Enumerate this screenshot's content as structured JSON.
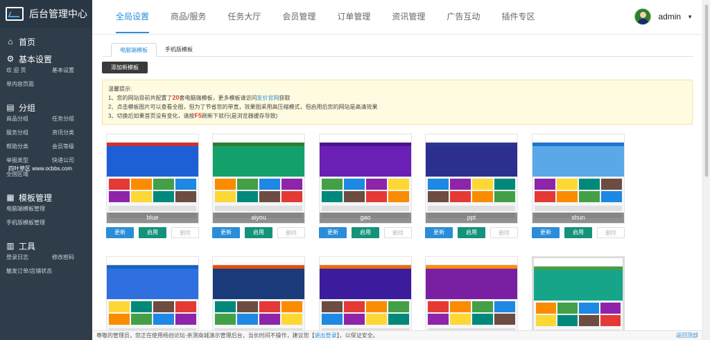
{
  "app": {
    "title": "后台管理中心"
  },
  "sidebar": {
    "groups": [
      {
        "icon": "home-icon",
        "glyph": "⌂",
        "label": "首页",
        "items": []
      },
      {
        "icon": "gear-icon",
        "glyph": "⚙",
        "label": "基本设置",
        "items": [
          "欢 迎 页",
          "基本设置",
          "单内容页面"
        ]
      },
      {
        "icon": "file-icon",
        "glyph": "▤",
        "label": "分组",
        "items": [
          "商品分组",
          "任务分组",
          "服务分组",
          "资讯分类",
          "帮助分类",
          "会员等级",
          "举报类型",
          "快递公司",
          "全国区域"
        ]
      },
      {
        "icon": "template-icon",
        "glyph": "▦",
        "label": "模板管理",
        "items": [
          "电脑端模板管理",
          "手机版模板管理"
        ]
      },
      {
        "icon": "chart-icon",
        "glyph": "▥",
        "label": "工具",
        "items": [
          "登录日志",
          "修改密码",
          "触发订单/店铺状态"
        ]
      }
    ],
    "watermark": "四叶草区  www.ocbbs.com"
  },
  "topnav": {
    "tabs": [
      "全局设置",
      "商品/服务",
      "任务大厅",
      "会员管理",
      "订单管理",
      "资讯管理",
      "广告互动",
      "插件专区"
    ],
    "active": 0
  },
  "user": {
    "name": "admin"
  },
  "subtabs": {
    "tabs": [
      "电脑端模板",
      "手机版模板"
    ],
    "active": 0
  },
  "toolbar": {
    "add_label": "添加新模板"
  },
  "tips": {
    "title": "温馨提示:",
    "line1_pre": "1、您的网站目前共配置了",
    "line1_count": "20",
    "line1_mid": "套电脑端模板，更多模板请访问",
    "line1_link": "友价官网",
    "line1_post": "获取",
    "line2": "2、点击模板图片可以查看全图，但为了节省您的带宽，效果图采用高压缩模式，但启用后您的网站是高清效果",
    "line3_pre": "3、切换后如果首页没有变化，请按",
    "line3_key": "F5",
    "line3_post": "刷新下就行(是浏览器缓存导致)"
  },
  "templates": {
    "update_label": "更新",
    "enable_label": "启用",
    "delete_label": "删除",
    "items": [
      {
        "name": "blue",
        "banner": "#1e5fd6",
        "nav": "#d32f2f"
      },
      {
        "name": "aiyou",
        "banner": "#14a06a",
        "nav": "#2e7d32"
      },
      {
        "name": "gao",
        "banner": "#6a1fb5",
        "nav": "#4a148c"
      },
      {
        "name": "ppt",
        "banner": "#2d2f8f",
        "nav": "#283593"
      },
      {
        "name": "shun",
        "banner": "#5aa8e8",
        "nav": "#1976d2"
      },
      {
        "name": "",
        "banner": "#2f6fe0",
        "nav": "#1565c0"
      },
      {
        "name": "",
        "banner": "#1b3a7a",
        "nav": "#e65100"
      },
      {
        "name": "",
        "banner": "#3a1c9c",
        "nav": "#ef6c00"
      },
      {
        "name": "",
        "banner": "#7b1fa2",
        "nav": "#ff8f00"
      },
      {
        "name": "",
        "banner": "#17a589",
        "nav": "#43a047"
      }
    ]
  },
  "footer": {
    "pre": "尊敬的管理员，您正在使用杨创论坛-亲测商城演示管理后台，当长时间不操作，建议您【",
    "link": "退出登录",
    "post": "】，以保证安全。",
    "back_top": "返回顶部"
  }
}
